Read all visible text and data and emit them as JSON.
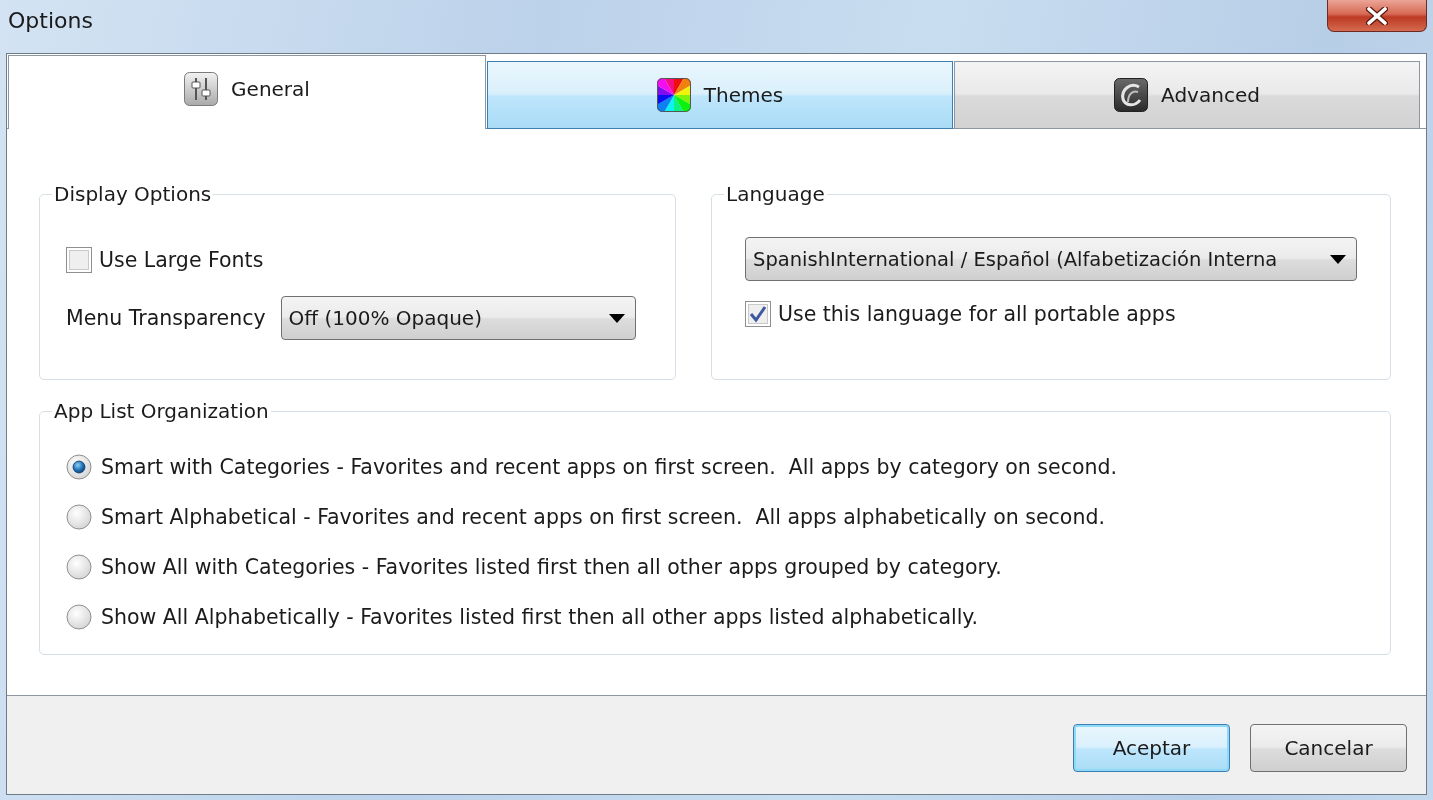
{
  "window": {
    "title": "Options"
  },
  "tabs": [
    {
      "label": "General",
      "selected": true,
      "hovered": false
    },
    {
      "label": "Themes",
      "selected": false,
      "hovered": true
    },
    {
      "label": "Advanced",
      "selected": false,
      "hovered": false
    }
  ],
  "display_options": {
    "title": "Display Options",
    "use_large_fonts": {
      "label": "Use Large Fonts",
      "checked": false
    },
    "menu_transparency": {
      "label": "Menu Transparency",
      "value": "Off (100% Opaque)"
    }
  },
  "language": {
    "title": "Language",
    "value": "SpanishInternational / Español (Alfabetización Interna",
    "use_for_all": {
      "label": "Use this language for all portable apps",
      "checked": true
    }
  },
  "app_list_organization": {
    "title": "App List Organization",
    "options": [
      {
        "label": "Smart with Categories - Favorites and recent apps on first screen.  All apps by category on second.",
        "selected": true
      },
      {
        "label": "Smart Alphabetical - Favorites and recent apps on first screen.  All apps alphabetically on second.",
        "selected": false
      },
      {
        "label": "Show All with Categories - Favorites listed first then all other apps grouped by category.",
        "selected": false
      },
      {
        "label": "Show All Alphabetically - Favorites listed first then all other apps listed alphabetically.",
        "selected": false
      }
    ]
  },
  "buttons": [
    {
      "label": "Aceptar",
      "default": true
    },
    {
      "label": "Cancelar",
      "default": false
    }
  ]
}
